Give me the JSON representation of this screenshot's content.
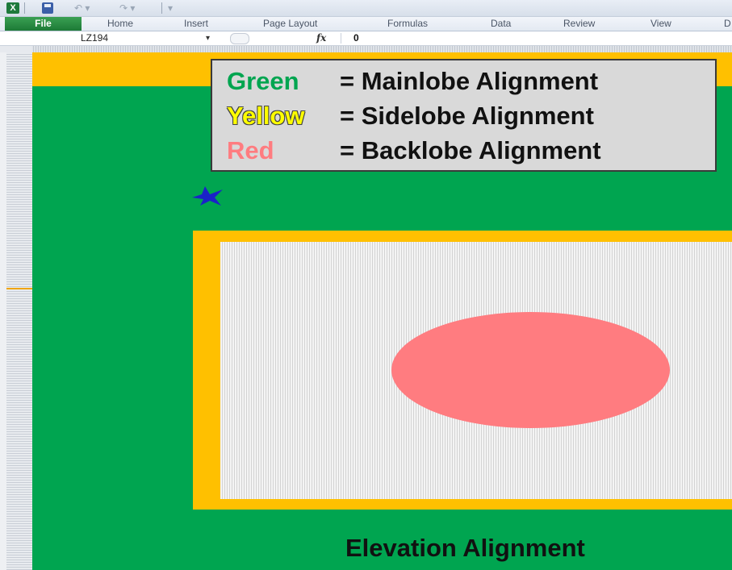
{
  "qat": {
    "app_icon_label": "X",
    "undo_glyph": "↶ ▾",
    "redo_glyph": "↷ ▾",
    "more_glyph": "▾"
  },
  "ribbon": {
    "tabs": [
      {
        "label": "File"
      },
      {
        "label": "Home"
      },
      {
        "label": "Insert"
      },
      {
        "label": "Page Layout"
      },
      {
        "label": "Formulas"
      },
      {
        "label": "Data"
      },
      {
        "label": "Review"
      },
      {
        "label": "View"
      },
      {
        "label": "D"
      }
    ]
  },
  "formula_bar": {
    "name_box": "LZ194",
    "dropdown_glyph": "▾",
    "fx_label": "fx",
    "value": "0"
  },
  "legend": {
    "rows": [
      {
        "key": "Green",
        "desc": "= Mainlobe Alignment"
      },
      {
        "key": "Yellow",
        "desc": "= Sidelobe Alignment"
      },
      {
        "key": "Red",
        "desc": "= Backlobe Alignment"
      }
    ]
  },
  "footer": {
    "title": "Elevation Alignment"
  },
  "colors": {
    "sheet_green": "#00a550",
    "frame_yellow": "#ffc000",
    "blob_red": "#ff7c80",
    "grid_gray": "#d3d3d3",
    "marker_blue": "#1a22c8"
  },
  "icons": {
    "app": "excel-icon",
    "save": "save-icon",
    "undo": "undo-icon",
    "redo": "redo-icon",
    "marker": "star-marker-icon"
  }
}
